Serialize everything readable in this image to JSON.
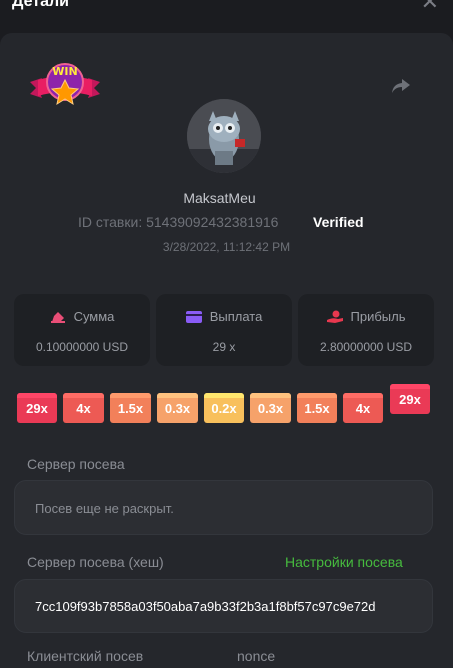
{
  "modal": {
    "title": "Детали",
    "close_glyph": "✕"
  },
  "logo": {
    "text": "WIN"
  },
  "user": {
    "name": "MaksatMeu "
  },
  "bet": {
    "id_label": "ID ставки: 51439092432381916",
    "verified_label": "Verified",
    "time": "3/28/2022, 11:12:42 PM"
  },
  "stats": {
    "amount": {
      "label": "Сумма",
      "value": "0.10000000 USD",
      "icon": "bet-chip-icon",
      "color": "#e94e77"
    },
    "payout": {
      "label": "Выплата",
      "value": "29 x",
      "icon": "card-icon",
      "color": "#8a5cf6"
    },
    "profit": {
      "label": "Прибыль",
      "value": "2.80000000 USD",
      "icon": "hand-coin-icon",
      "color": "#e8384f"
    }
  },
  "multipliers": [
    {
      "label": "29x",
      "color": "#ea3a56"
    },
    {
      "label": "4x",
      "color": "#ed5a54"
    },
    {
      "label": "1.5x",
      "color": "#f2805a"
    },
    {
      "label": "0.3x",
      "color": "#f6a26a"
    },
    {
      "label": "0.2x",
      "color": "#f8c05c"
    },
    {
      "label": "0.3x",
      "color": "#f6a26a"
    },
    {
      "label": "1.5x",
      "color": "#f2805a"
    },
    {
      "label": "4x",
      "color": "#ed5a54"
    },
    {
      "label": "29x",
      "color": "#ea3a56",
      "active": true
    }
  ],
  "seed": {
    "server_label": "Сервер посева",
    "server_placeholder": "Посев еще не раскрыт.",
    "hash_label": "Сервер посева (хеш)",
    "settings_link": "Настройки посева",
    "hash_value": "7cc109f93b7858a03f50aba7a9b33f2b3a1f8bf57c97c9e72d",
    "client_label": "Клиентский посев",
    "nonce_label": "nonce"
  }
}
